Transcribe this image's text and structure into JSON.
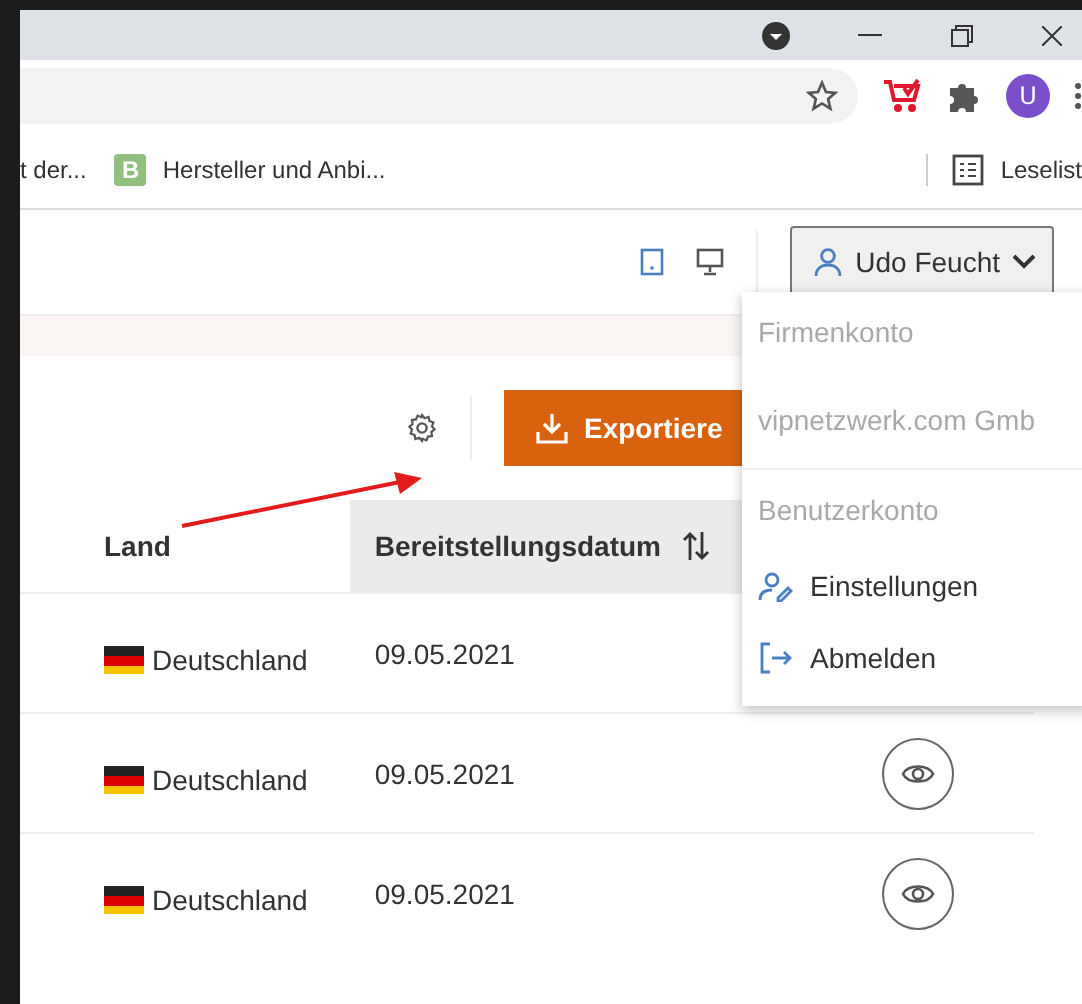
{
  "browser": {
    "profile_initial": "U",
    "bookmarks": [
      {
        "label": "t der...",
        "kind": "plain"
      },
      {
        "label": "Hersteller und Anbi...",
        "kind": "badge",
        "badge": "B"
      }
    ],
    "reading_list": "Leselist"
  },
  "header": {
    "user_button": "Udo Feucht"
  },
  "toolbar": {
    "export_button": "Exportiere"
  },
  "table": {
    "columns": [
      {
        "label": "Land",
        "sorted": false
      },
      {
        "label": "Bereitstellungsdatum",
        "sorted": true
      }
    ],
    "rows": [
      {
        "country": "Deutschland",
        "date": "09.05.2021"
      },
      {
        "country": "Deutschland",
        "date": "09.05.2021"
      },
      {
        "country": "Deutschland",
        "date": "09.05.2021"
      }
    ]
  },
  "user_menu": {
    "sections": [
      {
        "heading": "Firmenkonto",
        "items": [
          {
            "label": "vipnetzwerk.com Gmb",
            "kind": "info"
          }
        ]
      },
      {
        "heading": "Benutzerkonto",
        "items": [
          {
            "label": "Einstellungen",
            "kind": "settings"
          },
          {
            "label": "Abmelden",
            "kind": "logout"
          }
        ]
      }
    ]
  }
}
